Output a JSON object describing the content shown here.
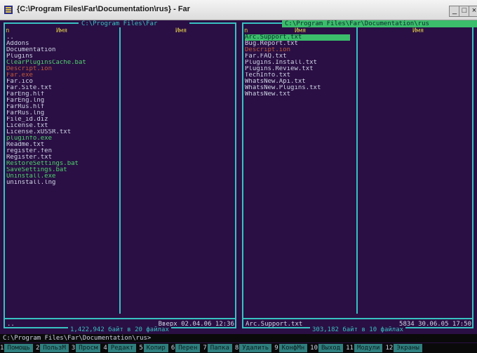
{
  "window": {
    "title": "{C:\\Program Files\\Far\\Documentation\\rus} - Far",
    "min": "_",
    "max": "□",
    "close": "×"
  },
  "left_panel": {
    "path": "C:\\Program Files\\Far",
    "col1_header": "Имя",
    "col2_header": "Имя",
    "col_n": "n",
    "files": [
      {
        "name": "..",
        "color": "white"
      },
      {
        "name": "Addons",
        "color": "white"
      },
      {
        "name": "Documentation",
        "color": "white"
      },
      {
        "name": "Plugins",
        "color": "white"
      },
      {
        "name": "ClearPluginsCache.bat",
        "color": "green"
      },
      {
        "name": "Descript.ion",
        "color": "orange"
      },
      {
        "name": "Far.exe",
        "color": "orange"
      },
      {
        "name": "Far.ico",
        "color": "white"
      },
      {
        "name": "Far.Site.txt",
        "color": "white"
      },
      {
        "name": "FarEng.hlf",
        "color": "white"
      },
      {
        "name": "FarEng.lng",
        "color": "white"
      },
      {
        "name": "FarRus.hlf",
        "color": "white"
      },
      {
        "name": "FarRus.lng",
        "color": "white"
      },
      {
        "name": "File_id.diz",
        "color": "white"
      },
      {
        "name": "License.txt",
        "color": "white"
      },
      {
        "name": "License.xUSSR.txt",
        "color": "white"
      },
      {
        "name": "pluginfo.exe",
        "color": "green"
      },
      {
        "name": "Readme.txt",
        "color": "white"
      },
      {
        "name": "register.fen",
        "color": "white"
      },
      {
        "name": "Register.txt",
        "color": "white"
      },
      {
        "name": "RestoreSettings.bat",
        "color": "green"
      },
      {
        "name": "SaveSettings.bat",
        "color": "green"
      },
      {
        "name": "Uninstall.exe",
        "color": "green"
      },
      {
        "name": "uninstall.lng",
        "color": "white"
      }
    ],
    "footer_left": "..",
    "footer_right": "Вверх 02.04.06 12:36",
    "summary": "1,422,942 байт в 20 файлах"
  },
  "right_panel": {
    "path": "C:\\Program Files\\Far\\Documentation\\rus",
    "col1_header": "Имя",
    "col2_header": "Имя",
    "col_n": "n",
    "files": [
      {
        "name": "Arc.Support.txt",
        "color": "selected"
      },
      {
        "name": "Bug.Report.txt",
        "color": "white"
      },
      {
        "name": "Descript.ion",
        "color": "orange"
      },
      {
        "name": "Far.FAQ.txt",
        "color": "white"
      },
      {
        "name": "Plugins.Install.txt",
        "color": "white"
      },
      {
        "name": "Plugins.Review.txt",
        "color": "white"
      },
      {
        "name": "TechInfo.txt",
        "color": "white"
      },
      {
        "name": "WhatsNew.Api.txt",
        "color": "white"
      },
      {
        "name": "WhatsNew.Plugins.txt",
        "color": "white"
      },
      {
        "name": "WhatsNew.txt",
        "color": "white"
      }
    ],
    "footer_left": "Arc.Support.txt",
    "footer_right": "5834 30.06.05 17:50",
    "summary": "303,182 байт в 10 файлах"
  },
  "command_line": "C:\\Program Files\\Far\\Documentation\\rus>",
  "keybar": [
    {
      "num": "1",
      "label": "Помощь"
    },
    {
      "num": "2",
      "label": "ПользМ"
    },
    {
      "num": "3",
      "label": "Просм"
    },
    {
      "num": "4",
      "label": "Редакт"
    },
    {
      "num": "5",
      "label": "Копир"
    },
    {
      "num": "6",
      "label": "Перен"
    },
    {
      "num": "7",
      "label": "Папка"
    },
    {
      "num": "8",
      "label": "Удалить"
    },
    {
      "num": "9",
      "label": "КонфМн"
    },
    {
      "num": "10",
      "label": "Выход"
    },
    {
      "num": "11",
      "label": "Модули"
    },
    {
      "num": "12",
      "label": "Экраны"
    }
  ]
}
